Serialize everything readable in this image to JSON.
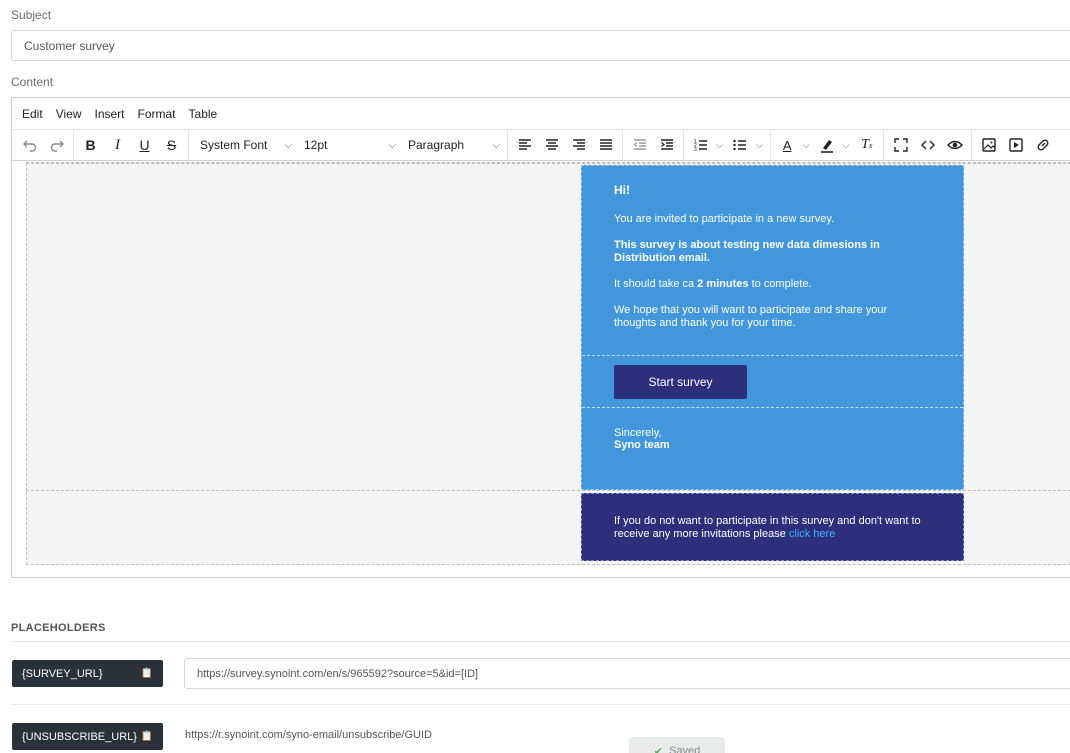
{
  "subject": {
    "label": "Subject",
    "value": "Customer survey"
  },
  "content": {
    "label": "Content"
  },
  "menubar": [
    "Edit",
    "View",
    "Insert",
    "Format",
    "Table"
  ],
  "toolbar": {
    "font": "System Font",
    "size": "12pt",
    "block": "Paragraph"
  },
  "email": {
    "greeting": "Hi!",
    "invite": "You are invited to participate in a new survey.",
    "about": "This survey is about testing new data dimesions in Distribution email.",
    "time_prefix": "It should take ca ",
    "time_bold": "2 minutes",
    "time_suffix": " to complete.",
    "hope": "We hope that you will want to participate and share your thoughts and thank you for your time.",
    "button": "Start survey",
    "sincerely": "Sincerely,",
    "team": "Syno team",
    "footer_text": "If you do not want to participate in this survey and don't want to receive any more invitations please ",
    "footer_link": "click here"
  },
  "placeholders": {
    "title": "PLACEHOLDERS",
    "items": [
      {
        "tag": "{SURVEY_URL}",
        "value": "https://survey.synoint.com/en/s/965592?source=5&id=[ID]"
      },
      {
        "tag": "{UNSUBSCRIBE_URL}",
        "value": "https://r.synoint.com/syno-email/unsubscribe/GUID"
      }
    ]
  },
  "save_button": "Saved",
  "colors": {
    "email_blue": "#4196dc",
    "email_navy": "#2c2f7c",
    "link": "#3fb1ff",
    "tag_bg": "#2b3138"
  }
}
